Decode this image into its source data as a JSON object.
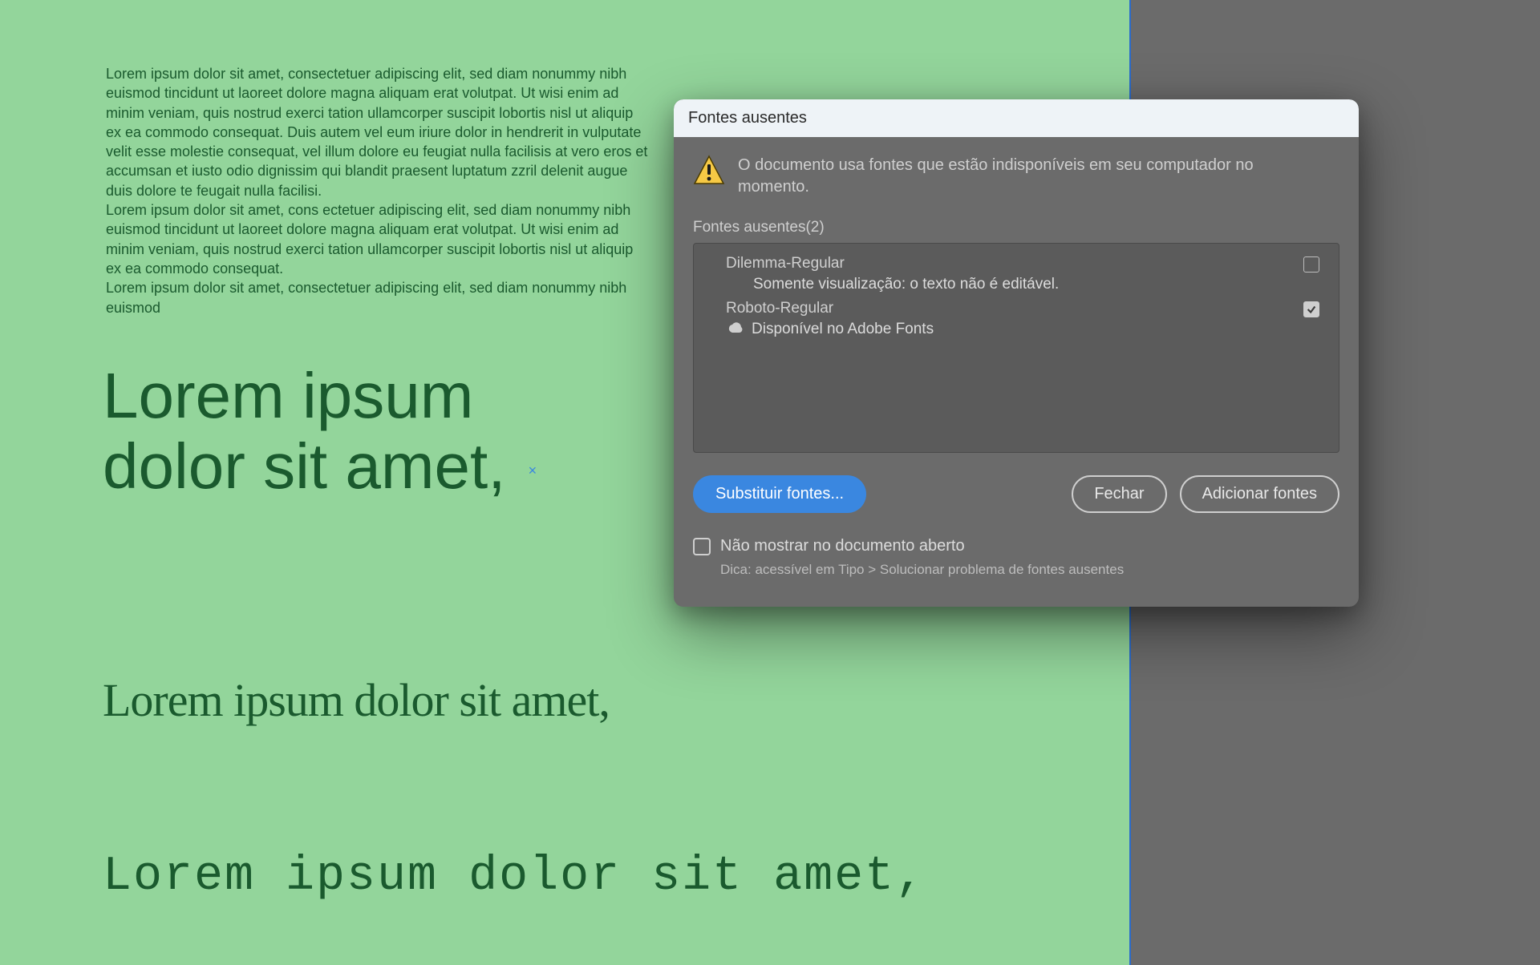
{
  "canvas": {
    "paragraph1": "Lorem ipsum dolor sit amet, consectetuer adipiscing elit, sed diam nonummy nibh euismod tincidunt ut laoreet dolore magna aliquam erat volutpat. Ut wisi enim ad minim veniam, quis nostrud exerci tation ullamcorper suscipit lobortis nisl ut aliquip ex ea commodo consequat. Duis autem vel eum iriure dolor in hendrerit in vulputate velit esse molestie consequat, vel illum dolore eu feugiat nulla facilisis at vero eros et accumsan et iusto odio dignissim qui blandit praesent luptatum zzril delenit augue duis dolore te feugait nulla facilisi.",
    "paragraph2": "Lorem ipsum dolor sit amet, cons ectetuer adipiscing elit, sed diam nonummy nibh euismod tincidunt ut laoreet dolore magna aliquam erat volutpat. Ut wisi enim ad minim veniam, quis nostrud exerci tation ullamcorper suscipit lobortis nisl ut aliquip ex ea commodo consequat.",
    "paragraph3": "Lorem ipsum dolor sit amet, consectetuer adipiscing elit, sed diam nonummy nibh euismod",
    "headline1_line1": "Lorem ipsum",
    "headline1_line2": "dolor sit amet,",
    "headline2": "Lorem ipsum dolor sit amet,",
    "headline3": "Lorem ipsum dolor sit amet,"
  },
  "dialog": {
    "title": "Fontes ausentes",
    "warning": "O documento usa fontes que estão indisponíveis em seu computador no momento.",
    "list_label": "Fontes ausentes(2)",
    "fonts": [
      {
        "name": "Dilemma-Regular",
        "status": "Somente visualização: o texto não é editável.",
        "checked": false,
        "adobe_fonts": false
      },
      {
        "name": "Roboto-Regular",
        "status": "Disponível no Adobe Fonts",
        "checked": true,
        "adobe_fonts": true
      }
    ],
    "buttons": {
      "replace": "Substituir fontes...",
      "close": "Fechar",
      "add": "Adicionar fontes"
    },
    "dont_show": "Não mostrar no documento aberto",
    "tip": "Dica: acessível em Tipo > Solucionar problema de fontes ausentes"
  }
}
